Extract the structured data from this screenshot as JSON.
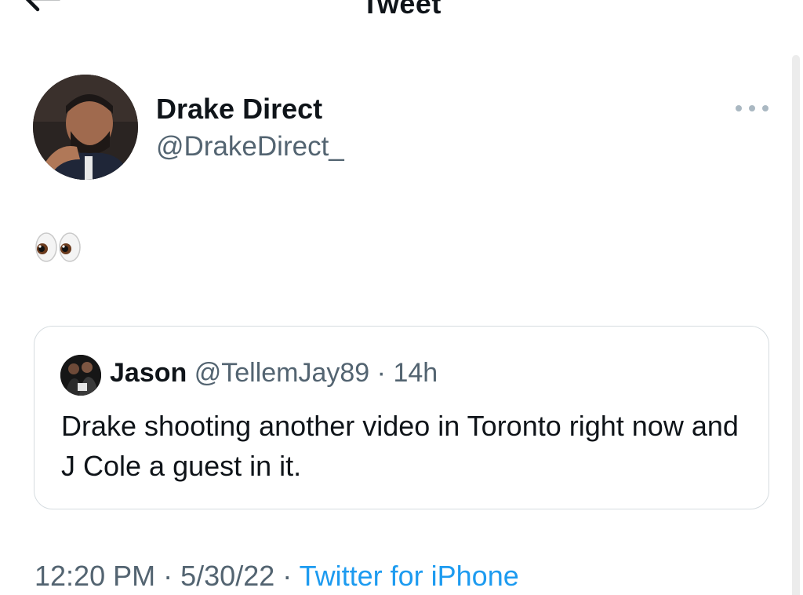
{
  "header": {
    "title": "Tweet"
  },
  "author": {
    "display_name": "Drake Direct",
    "handle": "@DrakeDirect_"
  },
  "tweet": {
    "text": "👀"
  },
  "quoted_tweet": {
    "display_name": "Jason",
    "handle": "@TellemJay89",
    "separator": "·",
    "time": "14h",
    "text": "Drake shooting another video in Toronto right now and J Cole a guest in it."
  },
  "meta": {
    "time": "12:20 PM",
    "sep1": "·",
    "date": "5/30/22",
    "sep2": "·",
    "source": "Twitter for iPhone"
  },
  "colors": {
    "link": "#1d9bf0",
    "secondary_text": "#536471",
    "primary_text": "#0f1419",
    "card_border": "#d6dce0"
  },
  "icons": {
    "back": "back-arrow-icon",
    "more": "more-dots-icon"
  }
}
